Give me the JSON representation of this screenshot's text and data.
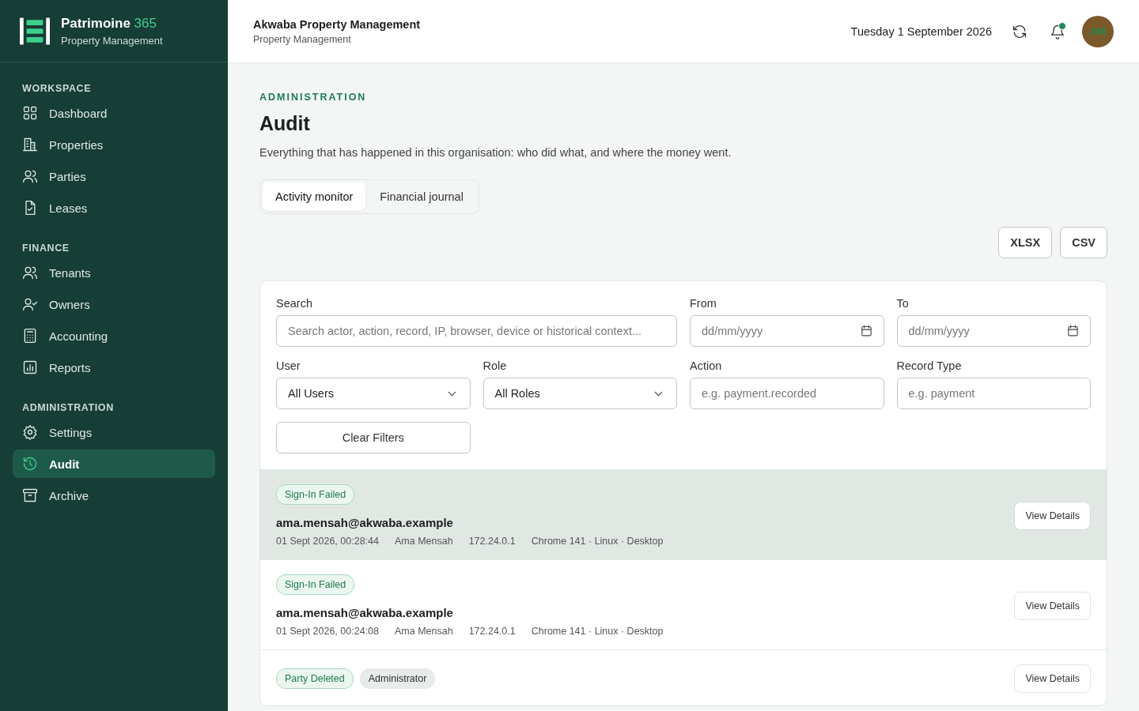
{
  "brand": {
    "name": "Patrimoine",
    "accent": "365",
    "subtitle": "Property Management"
  },
  "sidebar": {
    "sections": [
      {
        "title": "WORKSPACE",
        "items": [
          {
            "label": "Dashboard",
            "selected": false
          },
          {
            "label": "Properties",
            "selected": false
          },
          {
            "label": "Parties",
            "selected": false
          },
          {
            "label": "Leases",
            "selected": false
          }
        ]
      },
      {
        "title": "FINANCE",
        "items": [
          {
            "label": "Tenants",
            "selected": false
          },
          {
            "label": "Owners",
            "selected": false
          },
          {
            "label": "Accounting",
            "selected": false
          },
          {
            "label": "Reports",
            "selected": false
          }
        ]
      },
      {
        "title": "ADMINISTRATION",
        "items": [
          {
            "label": "Settings",
            "selected": false
          },
          {
            "label": "Audit",
            "selected": true
          },
          {
            "label": "Archive",
            "selected": false
          }
        ]
      }
    ]
  },
  "header": {
    "org": "Akwaba Property Management",
    "subtitle": "Property Management",
    "date": "Tuesday 1 September 2026",
    "notifications_unread": true,
    "avatar": "AM"
  },
  "page": {
    "eyebrow": "ADMINISTRATION",
    "title": "Audit",
    "description": "Everything that has happened in this organisation: who did what, and where the money went."
  },
  "tabs": [
    {
      "label": "Activity monitor",
      "selected": true
    },
    {
      "label": "Financial journal",
      "selected": false
    }
  ],
  "exports": [
    "XLSX",
    "CSV"
  ],
  "filters": {
    "search": {
      "label": "Search",
      "placeholder": "Search actor, action, record, IP, browser, device or historical context..."
    },
    "from": {
      "label": "From",
      "placeholder": "dd/mm/yyyy"
    },
    "to": {
      "label": "To",
      "placeholder": "dd/mm/yyyy"
    },
    "user": {
      "label": "User",
      "value": "All Users"
    },
    "role": {
      "label": "Role",
      "value": "All Roles"
    },
    "action": {
      "label": "Action",
      "placeholder": "e.g. payment.recorded"
    },
    "record_type": {
      "label": "Record Type",
      "placeholder": "e.g. payment"
    },
    "clear": "Clear Filters"
  },
  "events": [
    {
      "selected": true,
      "tags": [
        {
          "kind": "event",
          "label": "Sign-In Failed"
        }
      ],
      "title": "ama.mensah@akwaba.example",
      "meta": [
        "01 Sept 2026, 00:28:44",
        "Ama Mensah",
        "172.24.0.1",
        "Chrome 141 · Linux · Desktop"
      ],
      "action": "View Details"
    },
    {
      "selected": false,
      "tags": [
        {
          "kind": "event",
          "label": "Sign-In Failed"
        }
      ],
      "title": "ama.mensah@akwaba.example",
      "meta": [
        "01 Sept 2026, 00:24:08",
        "Ama Mensah",
        "172.24.0.1",
        "Chrome 141 · Linux · Desktop"
      ],
      "action": "View Details"
    },
    {
      "selected": false,
      "tags": [
        {
          "kind": "event",
          "label": "Party Deleted"
        },
        {
          "kind": "role",
          "label": "Administrator"
        }
      ],
      "action": "View Details"
    }
  ]
}
